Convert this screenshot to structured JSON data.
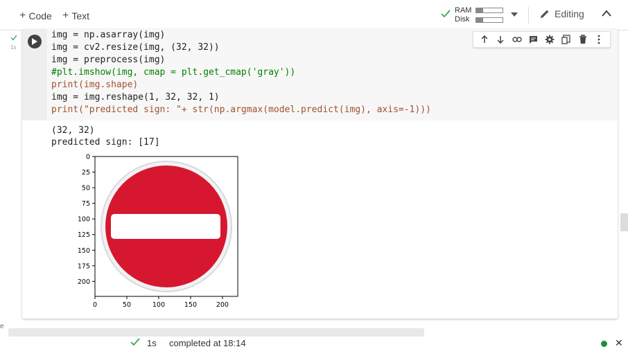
{
  "toolbar": {
    "add_code": "Code",
    "add_text": "Text",
    "ram_label": "RAM",
    "disk_label": "Disk",
    "ram_fill": 0.25,
    "disk_fill": 0.25,
    "mode_label": "Editing"
  },
  "cell": {
    "exec_time": "1s",
    "code_lines": [
      "img = np.asarray(img)",
      "img = cv2.resize(img, (32, 32))",
      "img = preprocess(img)",
      "#plt.imshow(img, cmap = plt.get_cmap('gray'))",
      "print(img.shape)",
      "img = img.reshape(1, 32, 32, 1)",
      "print(\"predicted sign: \"+ str(np.argmax(model.predict(img), axis=-1)))"
    ],
    "output_lines": [
      "(32, 32)",
      "predicted sign: [17]"
    ]
  },
  "chart_data": {
    "type": "image",
    "xticks": [
      "0",
      "50",
      "100",
      "150",
      "200"
    ],
    "yticks": [
      "0",
      "25",
      "50",
      "75",
      "100",
      "125",
      "150",
      "175",
      "200"
    ],
    "xlim": [
      0,
      224
    ],
    "ylim": [
      224,
      0
    ]
  },
  "status": {
    "duration": "1s",
    "message": "completed at 18:14"
  },
  "colors": {
    "sign_red": "#d7172f",
    "status_green": "#1e8e3e",
    "check_green": "#34a853"
  }
}
